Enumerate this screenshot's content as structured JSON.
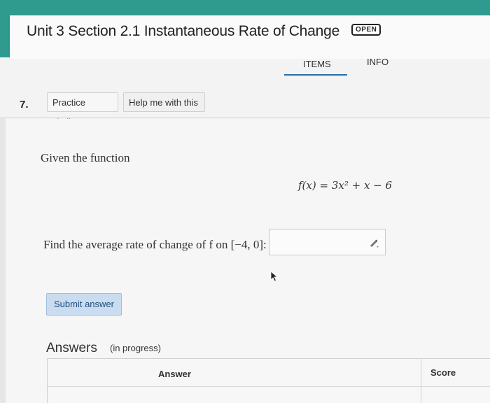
{
  "header": {
    "title": "Unit 3 Section 2.1 Instantaneous Rate of Change",
    "status_badge": "OPEN"
  },
  "tabs": [
    {
      "label": "ITEMS",
      "active": true
    },
    {
      "label": "INFO",
      "active": false
    }
  ],
  "question": {
    "number": "7.",
    "buttons": {
      "practice_similar": "Practice similar",
      "help_me": "Help me with this"
    },
    "prompt": "Given the function",
    "formula": "f(x) = 3x² + x − 6",
    "instruction": "Find the average rate of change of f on [−4, 0]:",
    "answer_value": "",
    "submit_label": "Submit answer"
  },
  "answers": {
    "title": "Answers",
    "subtitle": "(in progress)",
    "columns": [
      "Answer",
      "Score"
    ]
  },
  "colors": {
    "banner": "#2f9b8f",
    "tab_active_underline": "#2a6ea6",
    "submit_bg": "#c9dcf0"
  }
}
